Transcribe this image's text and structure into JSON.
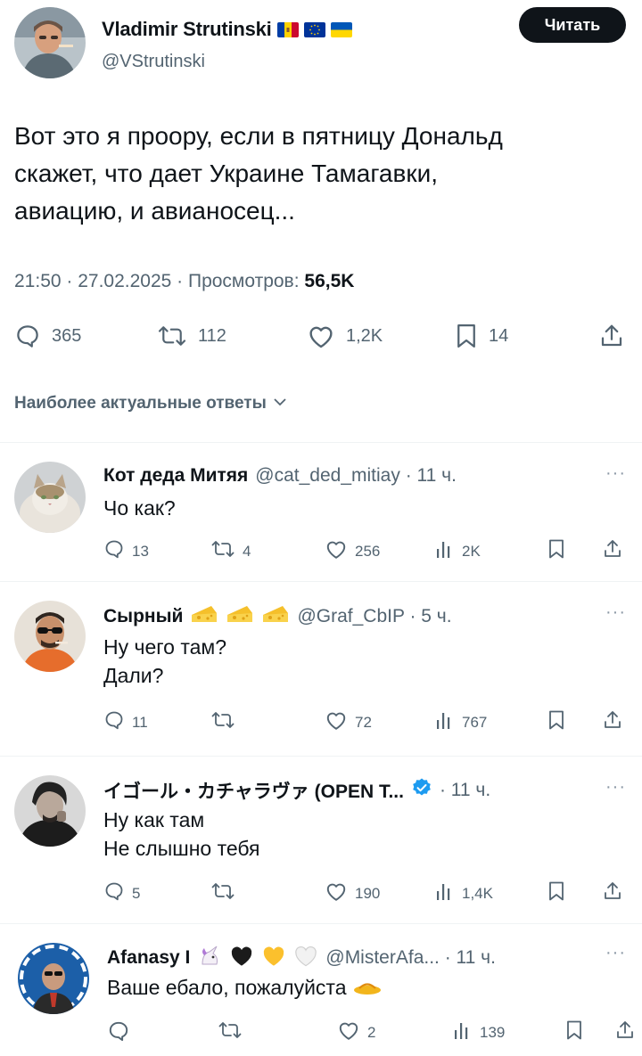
{
  "main_tweet": {
    "author_name": "Vladimir Strutinski",
    "author_handle": "@VStrutinski",
    "follow_label": "Читать",
    "text_line1": "Вот это я проору, если в пятницу Дональд",
    "text_line2": "скажет, что дает Украине Тамагавки,",
    "text_line3": "авиацию, и авианосец...",
    "timestamp": "21:50 · 27.02.2025 · Просмотров: ",
    "views": "56,5K",
    "replies": "365",
    "reposts": "112",
    "likes": "1,2K",
    "bookmarks": "14",
    "flags": [
      "moldova-flag-icon",
      "eu-flag-icon",
      "ukraine-flag-icon"
    ]
  },
  "sort_label": "Наиболее актуальные ответы",
  "replies": [
    {
      "name": "Кот деда Митяя",
      "handle": "@cat_ded_mitiay · 11 ч.",
      "line1": "Чо как?",
      "line2": "",
      "replies": "13",
      "reposts": "4",
      "likes": "256",
      "views": "2K"
    },
    {
      "name": "Сырный",
      "handle": "@Graf_CbIP · 5 ч.",
      "line1": "Ну чего там?",
      "line2": "Дали?",
      "replies": "11",
      "reposts": "",
      "likes": "72",
      "views": "767"
    },
    {
      "name": "イゴール・カチャラヴァ (OPEN T...",
      "handle": "· 11 ч.",
      "line1": "Ну как там",
      "line2": "Не слышно тебя",
      "replies": "5",
      "reposts": "",
      "likes": "190",
      "views": "1,4K"
    },
    {
      "name": "Afanasy I",
      "handle": "@MisterAfa... · 11 ч.",
      "line1": "Ваше ебало, пожалуйста",
      "line2": "",
      "replies": "",
      "reposts": "",
      "likes": "2",
      "views": "139"
    }
  ],
  "colors": {
    "text": "#0f1419",
    "muted": "#536471",
    "divider": "#eff3f4",
    "verified": "#1d9bf0"
  }
}
